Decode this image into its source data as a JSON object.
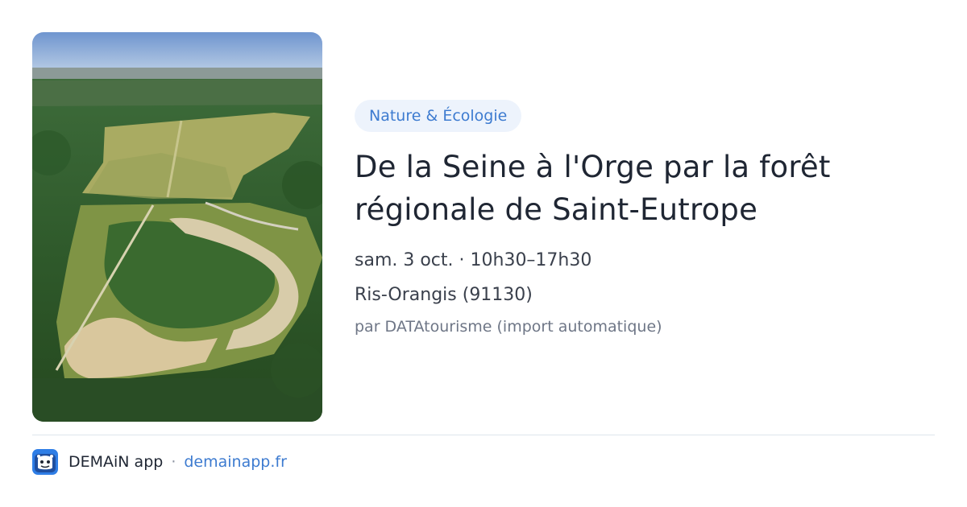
{
  "event": {
    "category": "Nature & Écologie",
    "title": "De la Seine à l'Orge par la forêt régionale de Saint-Eutrope",
    "schedule": "sam. 3 oct. · 10h30–17h30",
    "location": "Ris-Orangis (91130)",
    "source": "par DATAtourisme (import automatique)"
  },
  "footer": {
    "app_name": "DEMAiN app",
    "separator": "·",
    "domain": "demainapp.fr"
  },
  "colors": {
    "accent": "#3d7bd0",
    "tag_background": "#edf3fc",
    "title": "#1f2633",
    "muted": "#6e7686"
  },
  "icons": {
    "app": "demain-app-logo-icon"
  }
}
